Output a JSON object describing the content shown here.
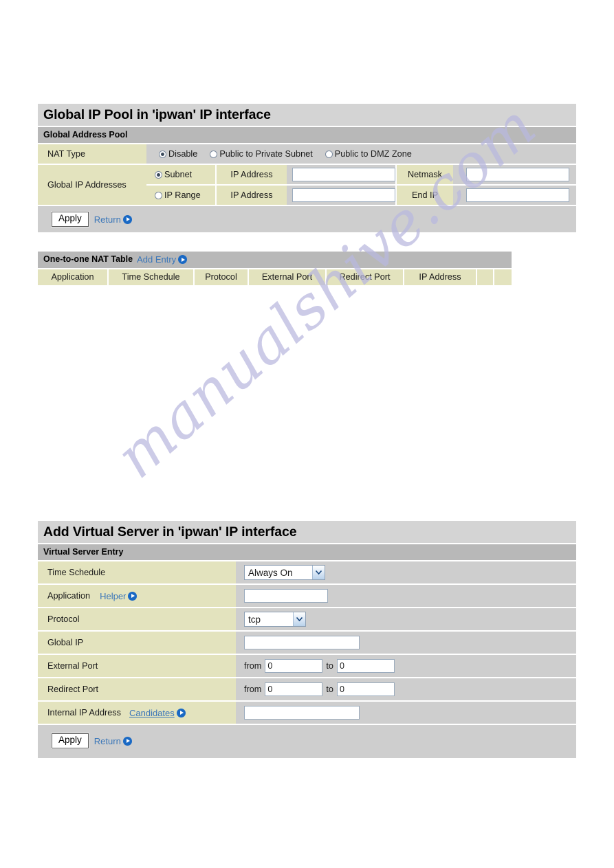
{
  "watermark": {
    "text": "manualshive.com"
  },
  "panel1": {
    "title": "Global IP Pool in 'ipwan' IP interface",
    "subtitle": "Global Address Pool",
    "nat_type": {
      "label": "NAT Type",
      "options": [
        {
          "label": "Disable",
          "selected": true
        },
        {
          "label": "Public to Private Subnet",
          "selected": false
        },
        {
          "label": "Public to DMZ Zone",
          "selected": false
        }
      ]
    },
    "global_ip_addresses": {
      "label": "Global IP Addresses",
      "rows": [
        {
          "mode": "Subnet",
          "mode_selected": true,
          "field1_label": "IP Address",
          "field1_value": "",
          "field2_label": "Netmask",
          "field2_value": ""
        },
        {
          "mode": "IP Range",
          "mode_selected": false,
          "field1_label": "IP Address",
          "field1_value": "",
          "field2_label": "End IP",
          "field2_value": ""
        }
      ]
    },
    "apply_label": "Apply",
    "return_label": "Return"
  },
  "nat_table": {
    "title": "One-to-one NAT Table",
    "add_entry_label": "Add Entry",
    "columns": [
      "Application",
      "Time Schedule",
      "Protocol",
      "External Port",
      "Redirect Port",
      "IP Address",
      "",
      ""
    ],
    "rows": []
  },
  "panel2": {
    "title": "Add Virtual Server in 'ipwan' IP interface",
    "subtitle": "Virtual Server Entry",
    "fields": {
      "time_schedule": {
        "label": "Time Schedule",
        "value": "Always On"
      },
      "application": {
        "label": "Application",
        "helper_label": "Helper",
        "value": ""
      },
      "protocol": {
        "label": "Protocol",
        "value": "tcp"
      },
      "global_ip": {
        "label": "Global IP",
        "value": ""
      },
      "external_port": {
        "label": "External Port",
        "from_label": "from",
        "from_value": "0",
        "to_label": "to",
        "to_value": "0"
      },
      "redirect_port": {
        "label": "Redirect Port",
        "from_label": "from",
        "from_value": "0",
        "to_label": "to",
        "to_value": "0"
      },
      "internal_ip": {
        "label": "Internal IP Address",
        "candidates_label": "Candidates",
        "value": ""
      }
    },
    "apply_label": "Apply",
    "return_label": "Return"
  },
  "colors": {
    "label_bg": "#e3e3be",
    "panel_bg": "#cecece",
    "title_bg": "#d4d4d4",
    "sub_bg": "#b8b8b8",
    "link": "#3a76b8",
    "watermark": "#b9b8df"
  }
}
